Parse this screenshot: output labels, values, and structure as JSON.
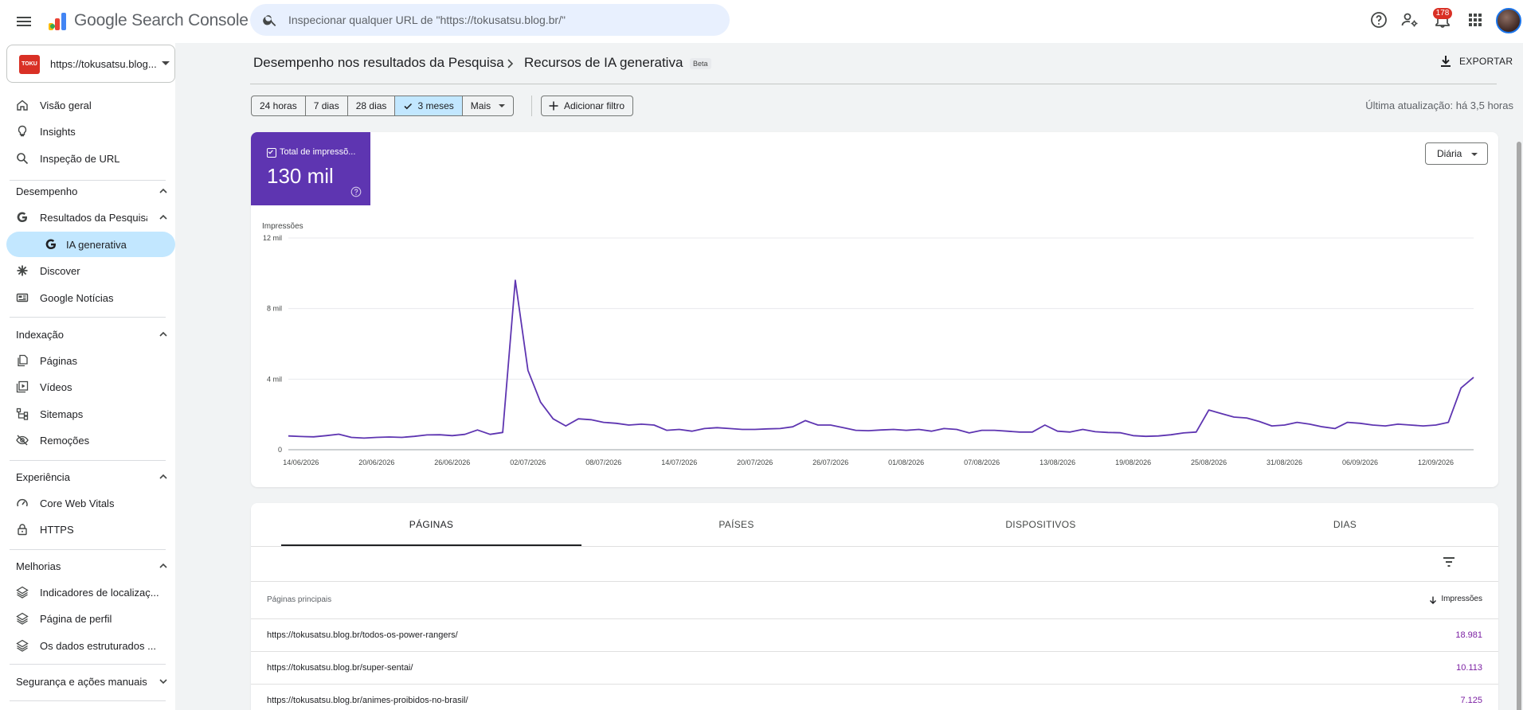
{
  "topbar": {
    "brand": "Google Search Console",
    "search_placeholder": "Inspecionar qualquer URL de \"https://tokusatsu.blog.br/\"",
    "notification_count": "178",
    "icons": [
      "menu-icon",
      "search-icon",
      "help-icon",
      "manage-users-icon",
      "notifications-icon",
      "apps-icon"
    ]
  },
  "sidebar": {
    "property": "https://tokusatsu.blog...",
    "property_favicon_text": "TOKU BLOG",
    "items": [
      {
        "label": "Visão geral",
        "icon": "home-icon"
      },
      {
        "label": "Insights",
        "icon": "lightbulb-icon"
      },
      {
        "label": "Inspeção de URL",
        "icon": "search-icon"
      }
    ],
    "sections": {
      "desempenho": {
        "label": "Desempenho",
        "items": [
          {
            "label": "Resultados da Pesquisa",
            "icon": "google-g-icon"
          },
          {
            "label": "IA generativa",
            "icon": "google-g-icon"
          },
          {
            "label": "Discover",
            "icon": "asterisk-icon"
          },
          {
            "label": "Google Notícias",
            "icon": "news-icon"
          }
        ]
      },
      "indexacao": {
        "label": "Indexação",
        "items": [
          {
            "label": "Páginas",
            "icon": "pages-icon"
          },
          {
            "label": "Vídeos",
            "icon": "video-icon"
          },
          {
            "label": "Sitemaps",
            "icon": "sitemap-icon"
          },
          {
            "label": "Remoções",
            "icon": "eye-off-icon"
          }
        ]
      },
      "experiencia": {
        "label": "Experiência",
        "items": [
          {
            "label": "Core Web Vitals",
            "icon": "gauge-icon"
          },
          {
            "label": "HTTPS",
            "icon": "lock-icon"
          }
        ]
      },
      "melhorias": {
        "label": "Melhorias",
        "items": [
          {
            "label": "Indicadores de localizaç...",
            "icon": "layers-icon"
          },
          {
            "label": "Página de perfil",
            "icon": "layers-icon"
          },
          {
            "label": "Os dados estruturados ...",
            "icon": "layers-icon"
          }
        ]
      },
      "seguranca": {
        "label": "Segurança e ações manuais"
      }
    }
  },
  "header": {
    "crumb1": "Desempenho nos resultados da Pesquisa",
    "crumb2": "Recursos de IA generativa",
    "beta": "Beta",
    "export": "EXPORTAR"
  },
  "filters": {
    "ranges": [
      "24 horas",
      "7 dias",
      "28 dias",
      "3 meses",
      "Mais"
    ],
    "selected": "3 meses",
    "add_filter": "Adicionar filtro",
    "last_update": "Última atualização: há 3,5 horas"
  },
  "metric": {
    "label": "Total de impressõ...",
    "value": "130 mil"
  },
  "granularity": "Diária",
  "chart_data": {
    "type": "line",
    "ylabel": "Impressões",
    "y_ticks": [
      "0",
      "4 mil",
      "8 mil",
      "12 mil"
    ],
    "ylim": [
      0,
      12000
    ],
    "x_ticks": [
      "14/06/2026",
      "20/06/2026",
      "26/06/2026",
      "02/07/2026",
      "08/07/2026",
      "14/07/2026",
      "20/07/2026",
      "26/07/2026",
      "01/08/2026",
      "07/08/2026",
      "13/08/2026",
      "19/08/2026",
      "25/08/2026",
      "31/08/2026",
      "06/09/2026",
      "12/09/2026"
    ],
    "start_date": "13/06/2026",
    "series": [
      {
        "name": "Impressões",
        "color": "#5e35b1",
        "values": [
          780,
          750,
          730,
          800,
          880,
          700,
          660,
          700,
          720,
          700,
          760,
          840,
          850,
          800,
          870,
          1120,
          870,
          980,
          9600,
          4500,
          2700,
          1750,
          1350,
          1750,
          1700,
          1550,
          1500,
          1400,
          1450,
          1400,
          1100,
          1150,
          1050,
          1200,
          1250,
          1200,
          1150,
          1150,
          1180,
          1200,
          1300,
          1650,
          1400,
          1400,
          1250,
          1100,
          1080,
          1120,
          1150,
          1100,
          1150,
          1050,
          1200,
          1150,
          950,
          1100,
          1100,
          1050,
          1000,
          1000,
          1400,
          1050,
          1000,
          1150,
          1020,
          980,
          960,
          800,
          760,
          780,
          850,
          950,
          1000,
          2250,
          2050,
          1850,
          1800,
          1600,
          1350,
          1400,
          1550,
          1450,
          1300,
          1200,
          1550,
          1500,
          1400,
          1350,
          1450,
          1400,
          1350,
          1400,
          1550,
          3500,
          4100
        ]
      }
    ]
  },
  "table": {
    "tabs": [
      "PÁGINAS",
      "PAÍSES",
      "DISPOSITIVOS",
      "DIAS"
    ],
    "col_left": "Páginas principais",
    "col_right": "Impressões",
    "rows": [
      {
        "url": "https://tokusatsu.blog.br/todos-os-power-rangers/",
        "value": "18.981"
      },
      {
        "url": "https://tokusatsu.blog.br/super-sentai/",
        "value": "10.113"
      },
      {
        "url": "https://tokusatsu.blog.br/animes-proibidos-no-brasil/",
        "value": "7.125"
      }
    ]
  }
}
